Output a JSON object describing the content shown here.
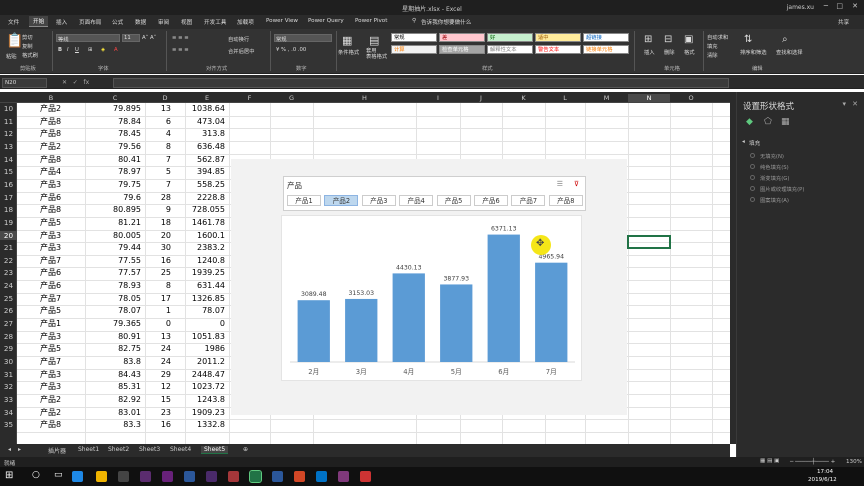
{
  "window": {
    "title": "星期抽片.xlsx - Excel",
    "user": "james.xu"
  },
  "tabs": [
    "文件",
    "开始",
    "插入",
    "页面布局",
    "公式",
    "数据",
    "审阅",
    "视图",
    "开发工具",
    "加载项",
    "Power View",
    "Power Query",
    "Power Pivot"
  ],
  "tell_me": "告诉我你想要做什么",
  "share": "共享",
  "ribbon": {
    "clipboard": {
      "cut": "剪切",
      "copy": "复制",
      "painter": "格式刷",
      "paste": "粘贴",
      "group": "剪贴板"
    },
    "font": {
      "name": "等线",
      "size": "11",
      "group": "字体"
    },
    "align": {
      "wrap": "自动换行",
      "merge": "合并后居中",
      "group": "对齐方式"
    },
    "number": {
      "format": "常规",
      "group": "数字"
    },
    "cond": "条件格式",
    "table_fmt": "套用\n表格格式",
    "styles": {
      "items": [
        {
          "label": "常规",
          "bg": "#ffffff",
          "fg": "#000000"
        },
        {
          "label": "差",
          "bg": "#ffc7ce",
          "fg": "#9c0006"
        },
        {
          "label": "好",
          "bg": "#c6efce",
          "fg": "#006100"
        },
        {
          "label": "适中",
          "bg": "#ffeb9c",
          "fg": "#9c5700"
        },
        {
          "label": "超链接",
          "bg": "#ffffff",
          "fg": "#0563c1"
        },
        {
          "label": "计算",
          "bg": "#f2f2f2",
          "fg": "#fa7d00"
        },
        {
          "label": "检查单元格",
          "bg": "#a5a5a5",
          "fg": "#ffffff"
        },
        {
          "label": "解释性文本",
          "bg": "#ffffff",
          "fg": "#7f7f7f"
        },
        {
          "label": "警告文本",
          "bg": "#ffffff",
          "fg": "#ff0000"
        },
        {
          "label": "链接单元格",
          "bg": "#ffffff",
          "fg": "#fa7d00"
        }
      ],
      "group": "样式"
    },
    "cells": {
      "insert": "插入",
      "delete": "删除",
      "format": "格式",
      "group": "单元格"
    },
    "editing": {
      "autosum": "自动求和",
      "fill": "填充",
      "clear": "清除",
      "sort": "排序和筛选",
      "find": "查找和选择",
      "group": "编辑"
    }
  },
  "namebox": "N20",
  "fx": [
    "✕",
    "✓",
    "fx"
  ],
  "columns": [
    "B",
    "C",
    "D",
    "E",
    "F",
    "G",
    "H",
    "I",
    "J",
    "K",
    "L",
    "M",
    "N",
    "O"
  ],
  "rows": [
    {
      "n": "10",
      "b": "产品2",
      "c": "79.895",
      "d": "13",
      "e": "1038.64"
    },
    {
      "n": "11",
      "b": "产品8",
      "c": "78.84",
      "d": "6",
      "e": "473.04"
    },
    {
      "n": "12",
      "b": "产品8",
      "c": "78.45",
      "d": "4",
      "e": "313.8"
    },
    {
      "n": "13",
      "b": "产品2",
      "c": "79.56",
      "d": "8",
      "e": "636.48"
    },
    {
      "n": "14",
      "b": "产品8",
      "c": "80.41",
      "d": "7",
      "e": "562.87"
    },
    {
      "n": "15",
      "b": "产品4",
      "c": "78.97",
      "d": "5",
      "e": "394.85"
    },
    {
      "n": "16",
      "b": "产品3",
      "c": "79.75",
      "d": "7",
      "e": "558.25"
    },
    {
      "n": "17",
      "b": "产品6",
      "c": "79.6",
      "d": "28",
      "e": "2228.8"
    },
    {
      "n": "18",
      "b": "产品8",
      "c": "80.895",
      "d": "9",
      "e": "728.055"
    },
    {
      "n": "19",
      "b": "产品5",
      "c": "81.21",
      "d": "18",
      "e": "1461.78"
    },
    {
      "n": "20",
      "b": "产品3",
      "c": "80.005",
      "d": "20",
      "e": "1600.1"
    },
    {
      "n": "21",
      "b": "产品3",
      "c": "79.44",
      "d": "30",
      "e": "2383.2"
    },
    {
      "n": "22",
      "b": "产品7",
      "c": "77.55",
      "d": "16",
      "e": "1240.8"
    },
    {
      "n": "23",
      "b": "产品6",
      "c": "77.57",
      "d": "25",
      "e": "1939.25"
    },
    {
      "n": "24",
      "b": "产品6",
      "c": "78.93",
      "d": "8",
      "e": "631.44"
    },
    {
      "n": "25",
      "b": "产品7",
      "c": "78.05",
      "d": "17",
      "e": "1326.85"
    },
    {
      "n": "26",
      "b": "产品5",
      "c": "78.07",
      "d": "1",
      "e": "78.07"
    },
    {
      "n": "27",
      "b": "产品1",
      "c": "79.365",
      "d": "0",
      "e": "0"
    },
    {
      "n": "28",
      "b": "产品3",
      "c": "80.91",
      "d": "13",
      "e": "1051.83"
    },
    {
      "n": "29",
      "b": "产品5",
      "c": "82.75",
      "d": "24",
      "e": "1986"
    },
    {
      "n": "30",
      "b": "产品7",
      "c": "83.8",
      "d": "24",
      "e": "2011.2"
    },
    {
      "n": "31",
      "b": "产品3",
      "c": "84.43",
      "d": "29",
      "e": "2448.47"
    },
    {
      "n": "32",
      "b": "产品3",
      "c": "85.31",
      "c2": "",
      "d": "12",
      "e": "1023.72"
    },
    {
      "n": "33",
      "b": "产品2",
      "c": "82.92",
      "d": "15",
      "e": "1243.8"
    },
    {
      "n": "34",
      "b": "产品2",
      "c": "83.01",
      "d": "23",
      "e": "1909.23"
    },
    {
      "n": "35",
      "b": "产品8",
      "c": "83.3",
      "d": "16",
      "e": "1332.8"
    }
  ],
  "slicer": {
    "title": "产品",
    "items": [
      "产品1",
      "产品2",
      "产品3",
      "产品4",
      "产品5",
      "产品6",
      "产品7",
      "产品8"
    ],
    "selected": "产品2"
  },
  "chart_data": {
    "type": "bar",
    "categories": [
      "2月",
      "3月",
      "4月",
      "5月",
      "6月",
      "7月"
    ],
    "values": [
      3089.48,
      3153.03,
      4430.13,
      3877.93,
      6371.13,
      4965.94
    ],
    "labels": [
      "3089.48",
      "3153.03",
      "4430.13",
      "3877.93",
      "6371.13",
      "4965.94"
    ],
    "title": "",
    "ylim": [
      0,
      7000
    ],
    "grid": false,
    "color": "#5b9bd5"
  },
  "sheets": [
    "插片器",
    "Sheet1",
    "Sheet2",
    "Sheet3",
    "Sheet4",
    "Sheet5"
  ],
  "active_sheet": "Sheet5",
  "status": {
    "left": "就绪",
    "zoom": "130%"
  },
  "pane": {
    "title": "设置形状格式",
    "section": "填充",
    "options": [
      "无填充(N)",
      "纯色填充(S)",
      "渐变填充(G)",
      "图片或纹理填充(P)",
      "图案填充(A)"
    ]
  },
  "clock": {
    "time": "17:04",
    "date": "2019/6/12"
  }
}
